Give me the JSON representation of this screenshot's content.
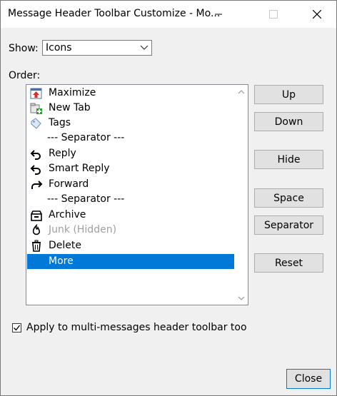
{
  "window": {
    "title": "Message Header Toolbar Customize - Mo..."
  },
  "show": {
    "label": "Show:",
    "selected": "Icons"
  },
  "order": {
    "label": "Order:",
    "items": [
      {
        "label": "Maximize",
        "icon": "maximize-icon",
        "type": "item"
      },
      {
        "label": "New Tab",
        "icon": "new-tab-icon",
        "type": "item"
      },
      {
        "label": "Tags",
        "icon": "tags-icon",
        "type": "item"
      },
      {
        "label": "--- Separator ---",
        "icon": "",
        "type": "separator"
      },
      {
        "label": "Reply",
        "icon": "reply-icon",
        "type": "item"
      },
      {
        "label": "Smart Reply",
        "icon": "smart-reply-icon",
        "type": "item"
      },
      {
        "label": "Forward",
        "icon": "forward-icon",
        "type": "item"
      },
      {
        "label": "--- Separator ---",
        "icon": "",
        "type": "separator"
      },
      {
        "label": "Archive",
        "icon": "archive-icon",
        "type": "item"
      },
      {
        "label": "Junk (Hidden)",
        "icon": "junk-icon",
        "type": "hidden"
      },
      {
        "label": "Delete",
        "icon": "delete-icon",
        "type": "item"
      },
      {
        "label": "More",
        "icon": "",
        "type": "item",
        "selected": true
      }
    ]
  },
  "buttons": {
    "up": "Up",
    "down": "Down",
    "hide": "Hide",
    "space": "Space",
    "separator": "Separator",
    "reset": "Reset",
    "close": "Close"
  },
  "apply": {
    "label": "Apply to multi-messages header toolbar too",
    "checked": true
  },
  "colors": {
    "selection": "#0078d7",
    "accent_red": "#d32f2f",
    "accent_green": "#2e9e3a"
  }
}
